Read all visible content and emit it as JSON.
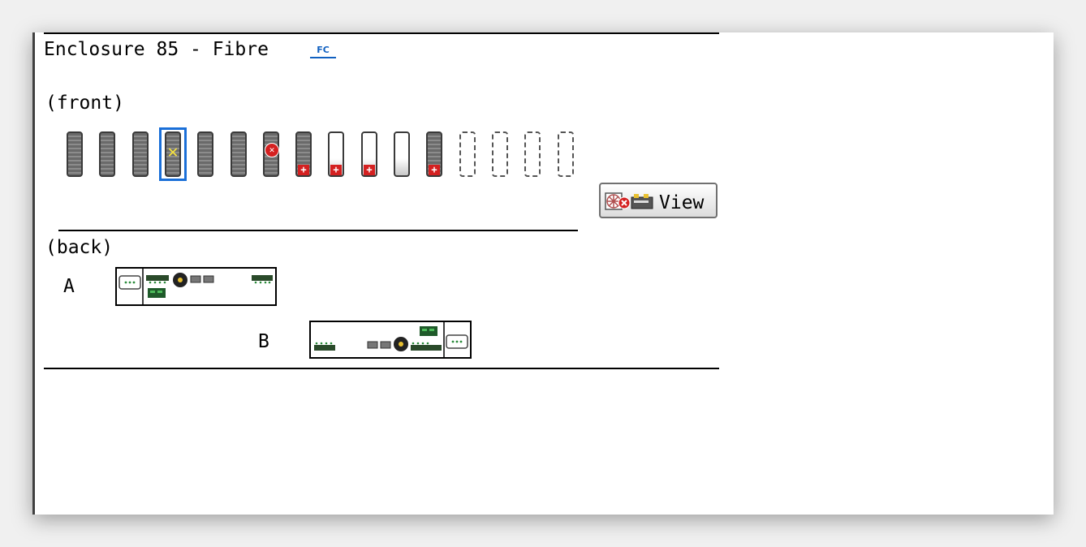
{
  "enclosure": {
    "title": "Enclosure 85 - Fibre",
    "badge": "FC",
    "badge_color": "#1060c0"
  },
  "front": {
    "label": "(front)",
    "slots": [
      {
        "state": "dark"
      },
      {
        "state": "dark"
      },
      {
        "state": "dark"
      },
      {
        "state": "dark",
        "selected": true,
        "marker": "x"
      },
      {
        "state": "dark"
      },
      {
        "state": "dark"
      },
      {
        "state": "dark",
        "marker": "error"
      },
      {
        "state": "dark",
        "marker": "plus"
      },
      {
        "state": "light",
        "marker": "plus"
      },
      {
        "state": "light",
        "marker": "plus"
      },
      {
        "state": "light"
      },
      {
        "state": "dark",
        "marker": "plus"
      },
      {
        "state": "empty"
      },
      {
        "state": "empty"
      },
      {
        "state": "empty"
      },
      {
        "state": "empty"
      }
    ],
    "view_button": {
      "label": "View",
      "icon": "fan-error-icon"
    }
  },
  "back": {
    "label": "(back)",
    "module_a": {
      "label": "A"
    },
    "module_b": {
      "label": "B"
    }
  },
  "colors": {
    "selection": "#1a6fd8",
    "error": "#d42020",
    "port_green": "#2a8a3a"
  }
}
